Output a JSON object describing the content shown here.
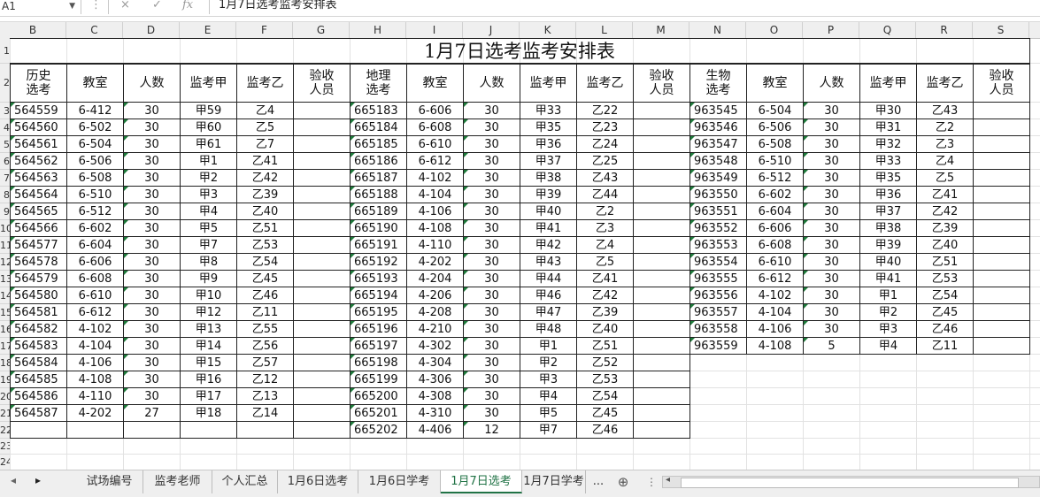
{
  "formula_bar": {
    "name_box": "A1",
    "formula": "1月7日选考监考安排表",
    "cancel_icon": "×",
    "confirm_icon": "✓",
    "fx_icon": "fx"
  },
  "columns": [
    "B",
    "C",
    "D",
    "E",
    "F",
    "G",
    "H",
    "I",
    "J",
    "K",
    "L",
    "M",
    "N",
    "O",
    "P",
    "Q",
    "R",
    "S"
  ],
  "rows": [
    "1",
    "2",
    "3",
    "4",
    "5",
    "6",
    "7",
    "8",
    "9",
    "10",
    "11",
    "12",
    "13",
    "14",
    "15",
    "16",
    "17",
    "18",
    "19",
    "20",
    "21",
    "22",
    "23",
    "24"
  ],
  "title": "1月7日选考监考安排表",
  "headers": {
    "history": [
      "历史选考",
      "教室",
      "人数",
      "监考甲",
      "监考乙",
      "验收人员"
    ],
    "geography": [
      "地理选考",
      "教室",
      "人数",
      "监考甲",
      "监考乙",
      "验收人员"
    ],
    "biology": [
      "生物选考",
      "教室",
      "人数",
      "监考甲",
      "监考乙",
      "验收人员"
    ]
  },
  "history_rows": [
    [
      "564559",
      "6-412",
      "30",
      "甲59",
      "乙4"
    ],
    [
      "564560",
      "6-502",
      "30",
      "甲60",
      "乙5"
    ],
    [
      "564561",
      "6-504",
      "30",
      "甲61",
      "乙7"
    ],
    [
      "564562",
      "6-506",
      "30",
      "甲1",
      "乙41"
    ],
    [
      "564563",
      "6-508",
      "30",
      "甲2",
      "乙42"
    ],
    [
      "564564",
      "6-510",
      "30",
      "甲3",
      "乙39"
    ],
    [
      "564565",
      "6-512",
      "30",
      "甲4",
      "乙40"
    ],
    [
      "564566",
      "6-602",
      "30",
      "甲5",
      "乙51"
    ],
    [
      "564577",
      "6-604",
      "30",
      "甲7",
      "乙53"
    ],
    [
      "564578",
      "6-606",
      "30",
      "甲8",
      "乙54"
    ],
    [
      "564579",
      "6-608",
      "30",
      "甲9",
      "乙45"
    ],
    [
      "564580",
      "6-610",
      "30",
      "甲10",
      "乙46"
    ],
    [
      "564581",
      "6-612",
      "30",
      "甲12",
      "乙11"
    ],
    [
      "564582",
      "4-102",
      "30",
      "甲13",
      "乙55"
    ],
    [
      "564583",
      "4-104",
      "30",
      "甲14",
      "乙56"
    ],
    [
      "564584",
      "4-106",
      "30",
      "甲15",
      "乙57"
    ],
    [
      "564585",
      "4-108",
      "30",
      "甲16",
      "乙12"
    ],
    [
      "564586",
      "4-110",
      "30",
      "甲17",
      "乙13"
    ],
    [
      "564587",
      "4-202",
      "27",
      "甲18",
      "乙14"
    ]
  ],
  "geography_rows": [
    [
      "665183",
      "6-606",
      "30",
      "甲33",
      "乙22"
    ],
    [
      "665184",
      "6-608",
      "30",
      "甲35",
      "乙23"
    ],
    [
      "665185",
      "6-610",
      "30",
      "甲36",
      "乙24"
    ],
    [
      "665186",
      "6-612",
      "30",
      "甲37",
      "乙25"
    ],
    [
      "665187",
      "4-102",
      "30",
      "甲38",
      "乙43"
    ],
    [
      "665188",
      "4-104",
      "30",
      "甲39",
      "乙44"
    ],
    [
      "665189",
      "4-106",
      "30",
      "甲40",
      "乙2"
    ],
    [
      "665190",
      "4-108",
      "30",
      "甲41",
      "乙3"
    ],
    [
      "665191",
      "4-110",
      "30",
      "甲42",
      "乙4"
    ],
    [
      "665192",
      "4-202",
      "30",
      "甲43",
      "乙5"
    ],
    [
      "665193",
      "4-204",
      "30",
      "甲44",
      "乙41"
    ],
    [
      "665194",
      "4-206",
      "30",
      "甲46",
      "乙42"
    ],
    [
      "665195",
      "4-208",
      "30",
      "甲47",
      "乙39"
    ],
    [
      "665196",
      "4-210",
      "30",
      "甲48",
      "乙40"
    ],
    [
      "665197",
      "4-302",
      "30",
      "甲1",
      "乙51"
    ],
    [
      "665198",
      "4-304",
      "30",
      "甲2",
      "乙52"
    ],
    [
      "665199",
      "4-306",
      "30",
      "甲3",
      "乙53"
    ],
    [
      "665200",
      "4-308",
      "30",
      "甲4",
      "乙54"
    ],
    [
      "665201",
      "4-310",
      "30",
      "甲5",
      "乙45"
    ],
    [
      "665202",
      "4-406",
      "12",
      "甲7",
      "乙46"
    ]
  ],
  "biology_rows": [
    [
      "963545",
      "6-504",
      "30",
      "甲30",
      "乙43"
    ],
    [
      "963546",
      "6-506",
      "30",
      "甲31",
      "乙2"
    ],
    [
      "963547",
      "6-508",
      "30",
      "甲32",
      "乙3"
    ],
    [
      "963548",
      "6-510",
      "30",
      "甲33",
      "乙4"
    ],
    [
      "963549",
      "6-512",
      "30",
      "甲35",
      "乙5"
    ],
    [
      "963550",
      "6-602",
      "30",
      "甲36",
      "乙41"
    ],
    [
      "963551",
      "6-604",
      "30",
      "甲37",
      "乙42"
    ],
    [
      "963552",
      "6-606",
      "30",
      "甲38",
      "乙39"
    ],
    [
      "963553",
      "6-608",
      "30",
      "甲39",
      "乙40"
    ],
    [
      "963554",
      "6-610",
      "30",
      "甲40",
      "乙51"
    ],
    [
      "963555",
      "6-612",
      "30",
      "甲41",
      "乙53"
    ],
    [
      "963556",
      "4-102",
      "30",
      "甲1",
      "乙54"
    ],
    [
      "963557",
      "4-104",
      "30",
      "甲2",
      "乙45"
    ],
    [
      "963558",
      "4-106",
      "30",
      "甲3",
      "乙46"
    ],
    [
      "963559",
      "4-108",
      "5",
      "甲4",
      "乙11"
    ]
  ],
  "sheet_tabs": [
    {
      "label": "试场编号",
      "active": false
    },
    {
      "label": "监考老师",
      "active": false
    },
    {
      "label": "个人汇总",
      "active": false
    },
    {
      "label": "1月6日选考",
      "active": false
    },
    {
      "label": "1月6日学考",
      "active": false
    },
    {
      "label": "1月7日选考",
      "active": true
    },
    {
      "label": "1月7日学考",
      "active": false
    }
  ],
  "tab_more": "...",
  "add_sheet_icon": "⊕",
  "colors": {
    "accent": "#217346",
    "marker": "#1d7a3a"
  }
}
